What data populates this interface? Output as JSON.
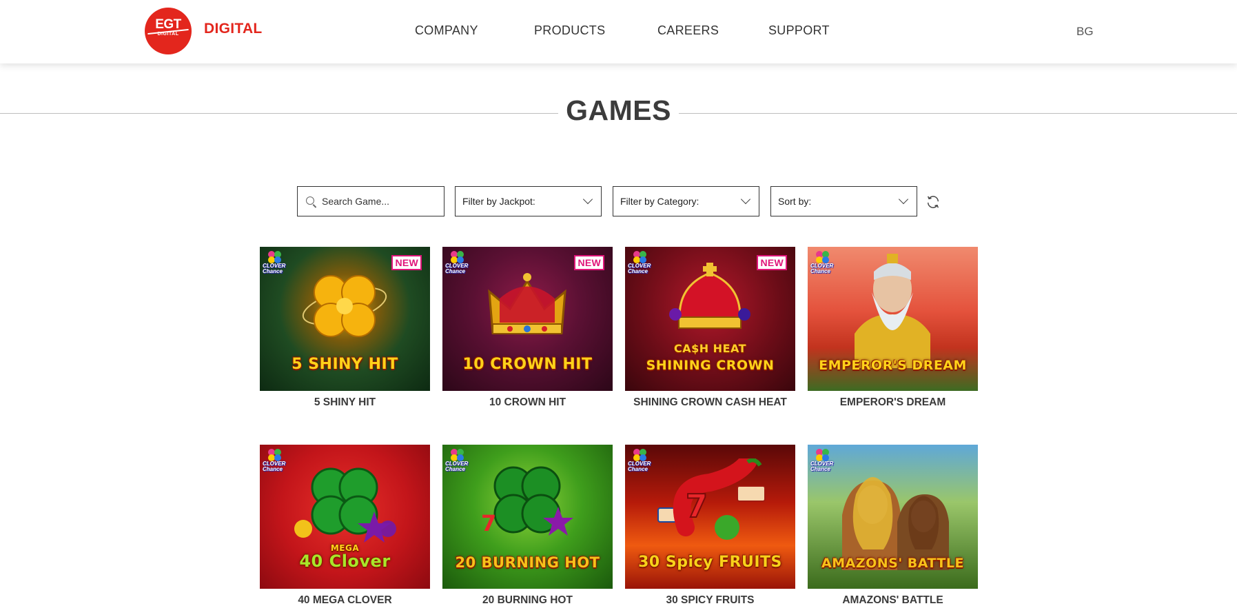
{
  "header": {
    "logo_text": "EGT",
    "logo_subtext": "DIGITAL",
    "brand": "DIGITAL",
    "nav": [
      {
        "label": "COMPANY"
      },
      {
        "label": "PRODUCTS"
      },
      {
        "label": "CAREERS"
      },
      {
        "label": "SUPPORT"
      }
    ],
    "language": "BG"
  },
  "page_title": "GAMES",
  "filters": {
    "search_placeholder": "Search Game...",
    "jackpot": "Filter by Jackpot:",
    "category": "Filter by Category:",
    "sort": "Sort by:"
  },
  "games": [
    {
      "title": "5 SHINY HIT",
      "art_text": "5 SHINY HIT",
      "badge": "NEW",
      "jackpot_badge": "CLOVER Chance"
    },
    {
      "title": "10 CROWN HIT",
      "art_text": "10 CROWN HIT",
      "badge": "NEW",
      "jackpot_badge": "CLOVER Chance"
    },
    {
      "title": "SHINING CROWN CASH HEAT",
      "art_text": "SHINING CROWN",
      "art_subtext": "CA$H HEAT",
      "badge": "NEW",
      "jackpot_badge": "CLOVER Chance"
    },
    {
      "title": "EMPEROR'S DREAM",
      "art_text": "EMPEROR'S DREAM",
      "jackpot_badge": "CLOVER Chance"
    },
    {
      "title": "40 MEGA CLOVER",
      "art_text": "40 Clover",
      "art_subtext": "MEGA",
      "jackpot_badge": "CLOVER Chance"
    },
    {
      "title": "20 BURNING HOT",
      "art_text": "20 BURNING HOT",
      "jackpot_badge": "CLOVER Chance"
    },
    {
      "title": "30 SPICY FRUITS",
      "art_text": "30 Spicy FRUITS",
      "jackpot_badge": "CLOVER Chance"
    },
    {
      "title": "AMAZONS' BATTLE",
      "art_text": "AMAZONS' BATTLE",
      "jackpot_badge": "CLOVER Chance"
    }
  ],
  "colors": {
    "brand_red": "#e3261d",
    "new_badge": "#e0157a"
  }
}
